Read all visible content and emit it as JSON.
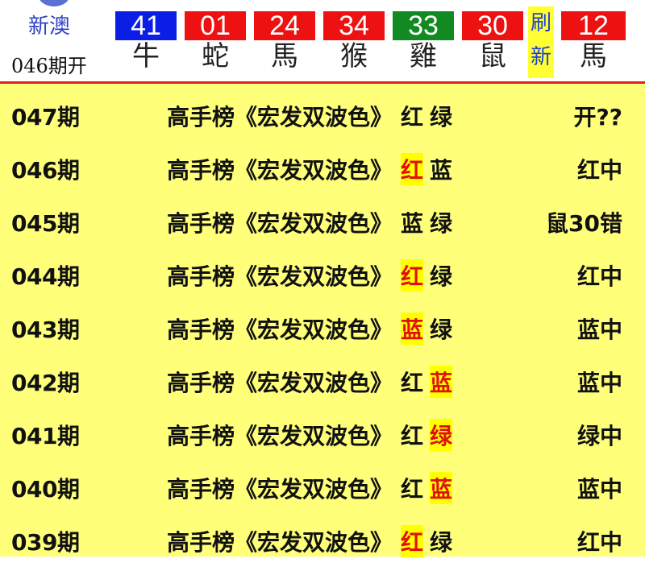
{
  "header": {
    "title": "新澳",
    "issue_label": "046期开",
    "refresh_label_1": "刷",
    "refresh_label_2": "新",
    "balls": [
      {
        "number": "41",
        "zodiac": "牛",
        "color": "#0b1ee6"
      },
      {
        "number": "01",
        "zodiac": "蛇",
        "color": "#ee1111"
      },
      {
        "number": "24",
        "zodiac": "馬",
        "color": "#ee1111"
      },
      {
        "number": "34",
        "zodiac": "猴",
        "color": "#ee1111"
      },
      {
        "number": "33",
        "zodiac": "雞",
        "color": "#128a22"
      },
      {
        "number": "30",
        "zodiac": "鼠",
        "color": "#ee1111"
      },
      {
        "number": "12",
        "zodiac": "馬",
        "color": "#ee1111"
      }
    ]
  },
  "list": {
    "rows": [
      {
        "period": "047期",
        "label": "高手榜《宏发双波色》",
        "c1": "红",
        "c2": "绿",
        "result": "开??"
      },
      {
        "period": "046期",
        "label": "高手榜《宏发双波色》",
        "c1": "红",
        "c2": "蓝",
        "result": "红中"
      },
      {
        "period": "045期",
        "label": "高手榜《宏发双波色》",
        "c1": "蓝",
        "c2": "绿",
        "result": "鼠30错"
      },
      {
        "period": "044期",
        "label": "高手榜《宏发双波色》",
        "c1": "红",
        "c2": "绿",
        "result": "红中"
      },
      {
        "period": "043期",
        "label": "高手榜《宏发双波色》",
        "c1": "蓝",
        "c2": "绿",
        "result": "蓝中"
      },
      {
        "period": "042期",
        "label": "高手榜《宏发双波色》",
        "c1": "红",
        "c2": "蓝",
        "result": "蓝中"
      },
      {
        "period": "041期",
        "label": "高手榜《宏发双波色》",
        "c1": "红",
        "c2": "绿",
        "result": "绿中"
      },
      {
        "period": "040期",
        "label": "高手榜《宏发双波色》",
        "c1": "红",
        "c2": "蓝",
        "result": "蓝中"
      },
      {
        "period": "039期",
        "label": "高手榜《宏发双波色》",
        "c1": "红",
        "c2": "绿",
        "result": "红中"
      }
    ]
  }
}
